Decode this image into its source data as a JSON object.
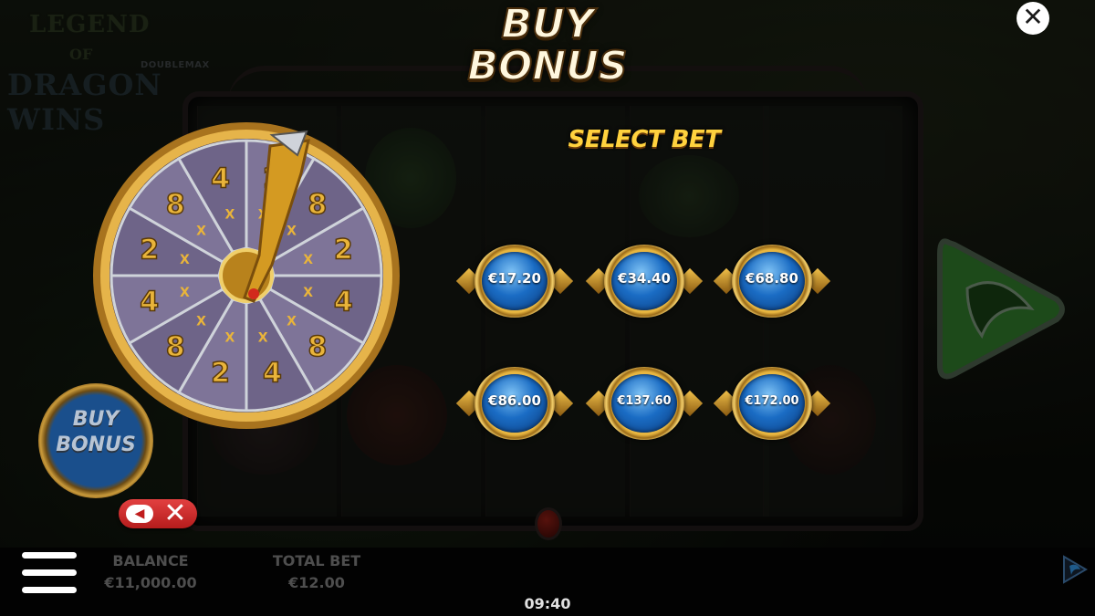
{
  "logo": {
    "line1": "LEGEND",
    "line2": "OF",
    "line3": "DRAGON WINS",
    "badge": "DOUBLEMAX"
  },
  "modal": {
    "title_line1": "BUY",
    "title_line2": "BONUS",
    "subtitle": "SELECT BET",
    "close_icon": "close-icon",
    "bets": [
      "€17.20",
      "€34.40",
      "€68.80",
      "€86.00",
      "€137.60",
      "€172.00"
    ]
  },
  "wheel": {
    "segments": [
      "2",
      "8",
      "2",
      "4",
      "8",
      "4",
      "2",
      "8",
      "4",
      "2",
      "8",
      "4"
    ],
    "multiplier_symbol": "X"
  },
  "side_button": {
    "line1": "BUY",
    "line2": "BONUS"
  },
  "bottom_bar": {
    "balance_label": "BALANCE",
    "balance_value": "€11,000.00",
    "total_bet_label": "TOTAL BET",
    "total_bet_value": "€12.00",
    "clock": "09:40"
  },
  "colors": {
    "title": "#fff7de",
    "subtitle": "#ffd23e",
    "orb": "#1a6cc4",
    "gold": "#e8b640",
    "spin_green": "#2f7a2a",
    "cancel_red": "#d22a2a"
  }
}
